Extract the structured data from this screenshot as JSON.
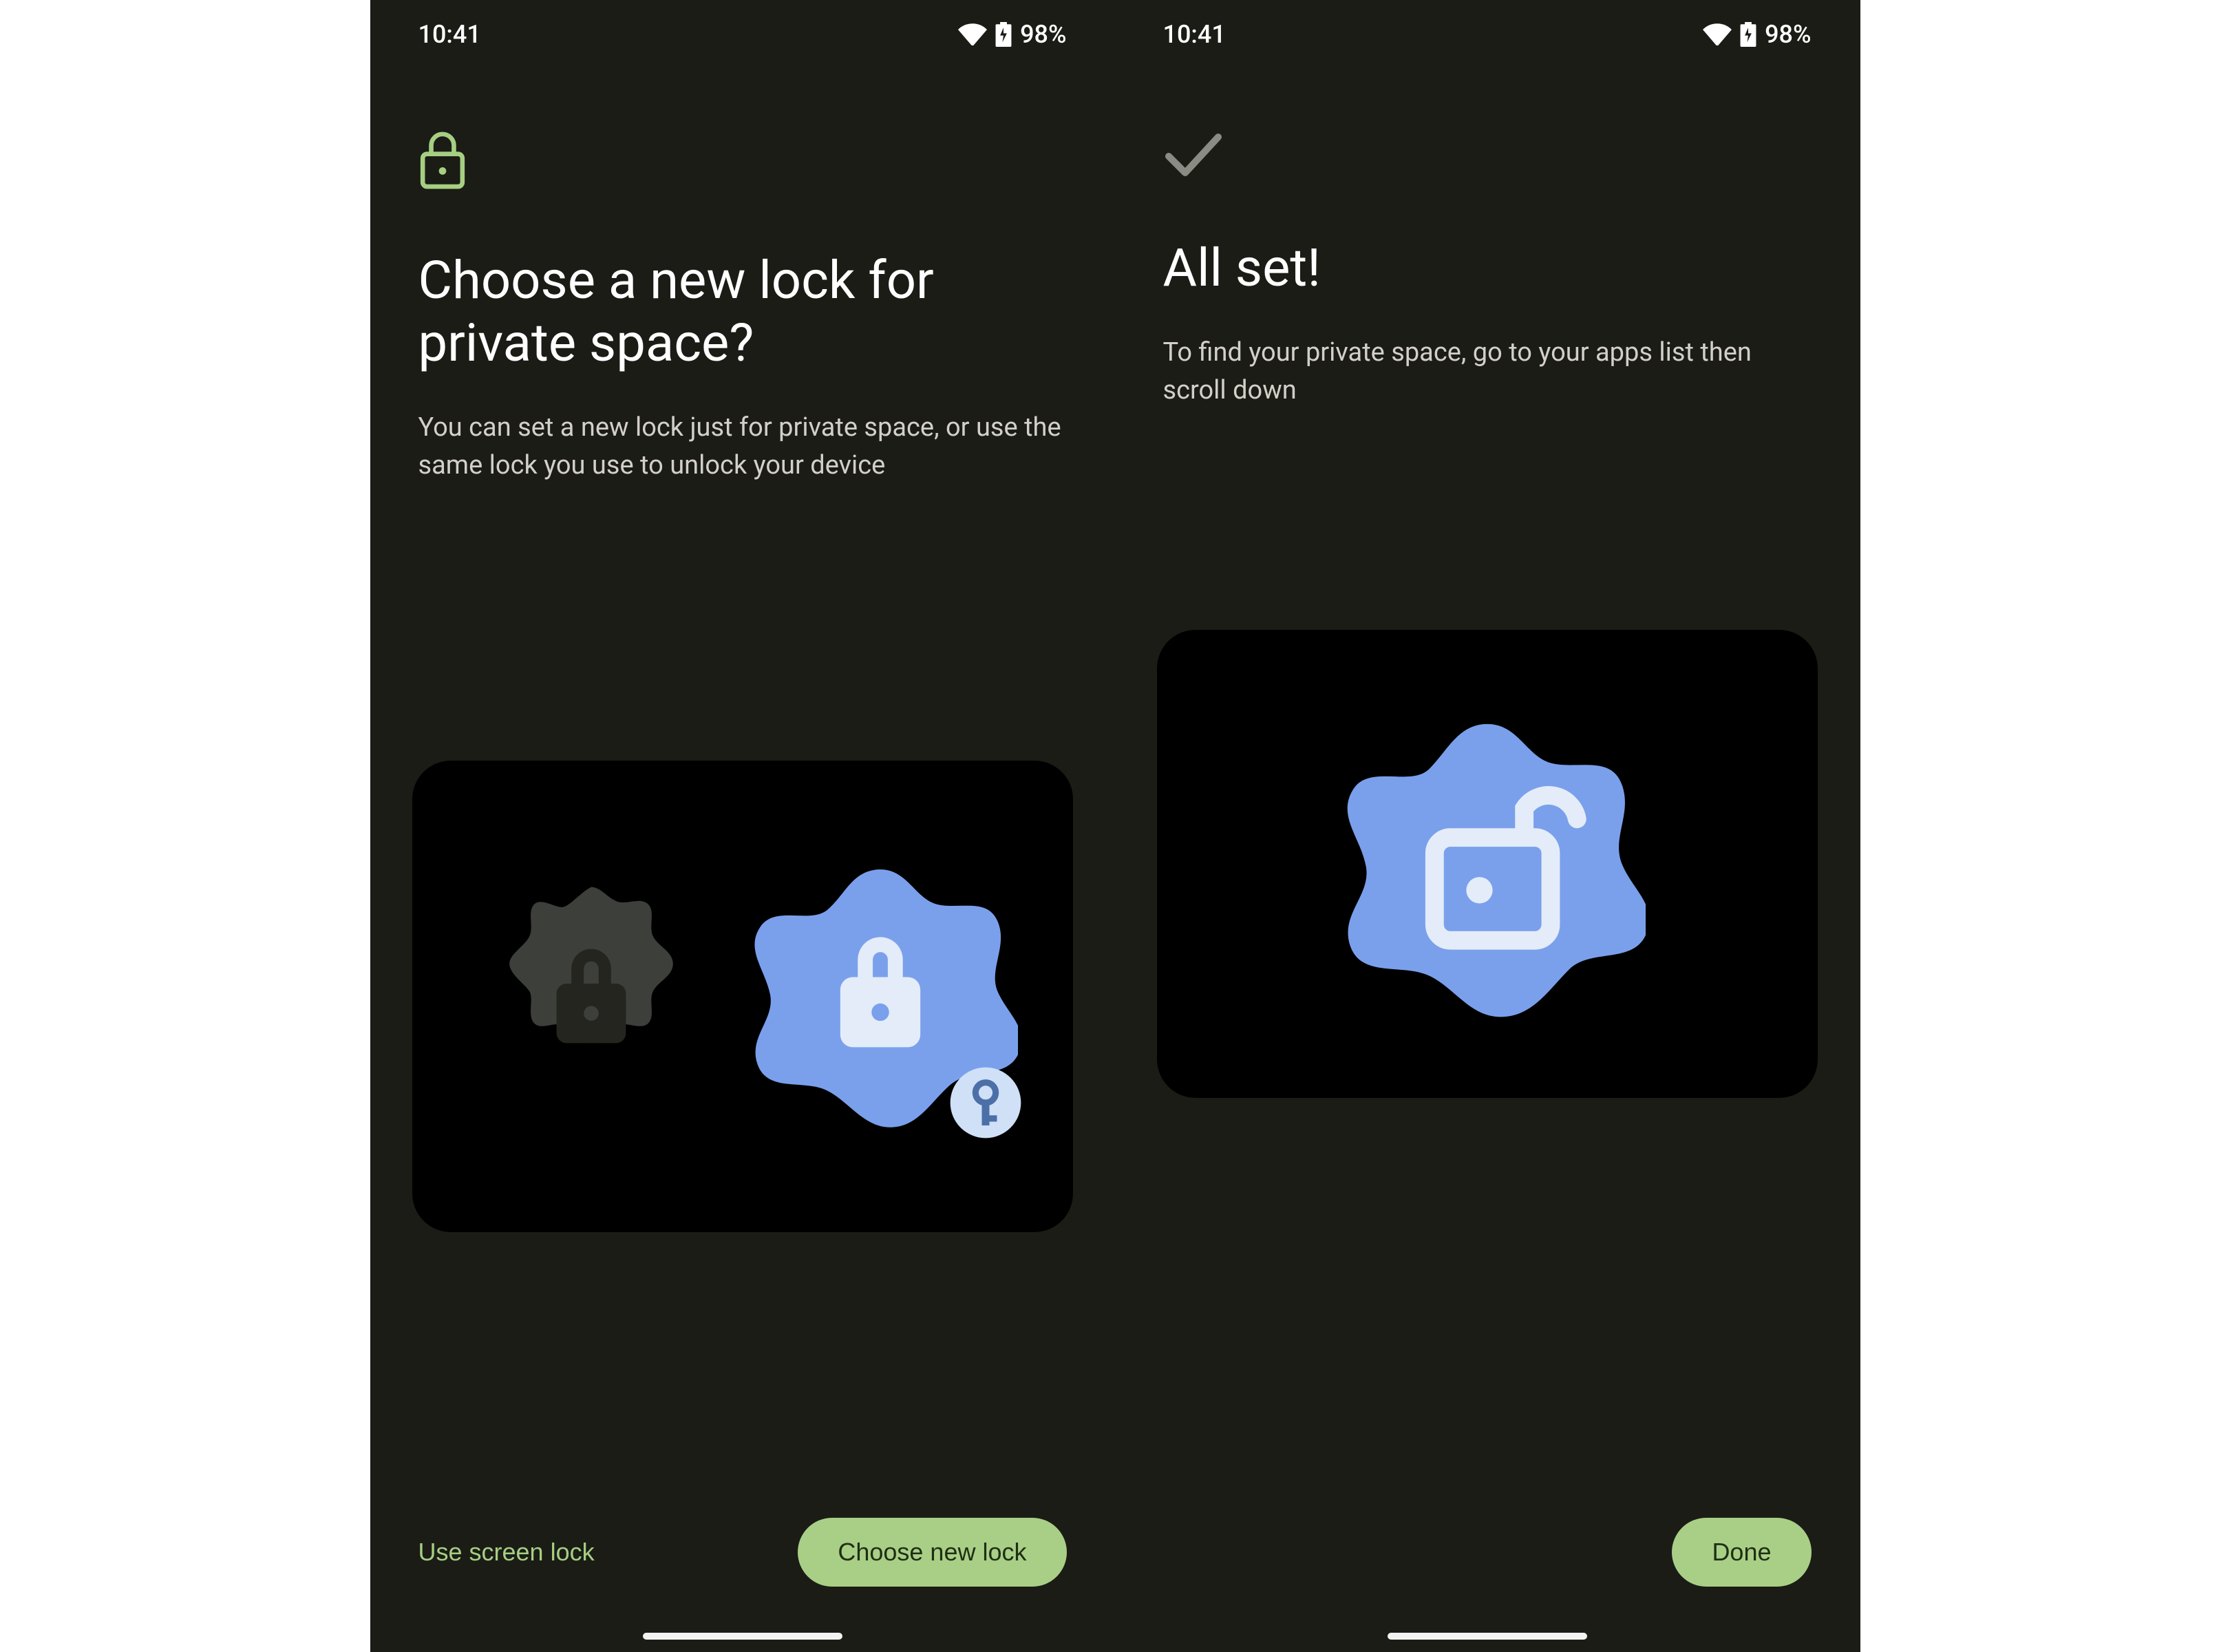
{
  "status": {
    "time": "10:41",
    "battery": "98%"
  },
  "screen_left": {
    "title": "Choose a new lock for private space?",
    "subtitle": "You can set a new lock just for private space, or use the same lock you use to unlock your device",
    "secondary_button": "Use screen lock",
    "primary_button": "Choose new lock"
  },
  "screen_right": {
    "title": "All set!",
    "subtitle": "To find your private space, go to your apps list then scroll down",
    "primary_button": "Done"
  },
  "colors": {
    "bg": "#1b1c16",
    "accent_green": "#a9cf86",
    "accent_blue": "#7aa0ec",
    "icon_light": "#e3ecf8",
    "dark_gray": "#3d3f3a"
  }
}
